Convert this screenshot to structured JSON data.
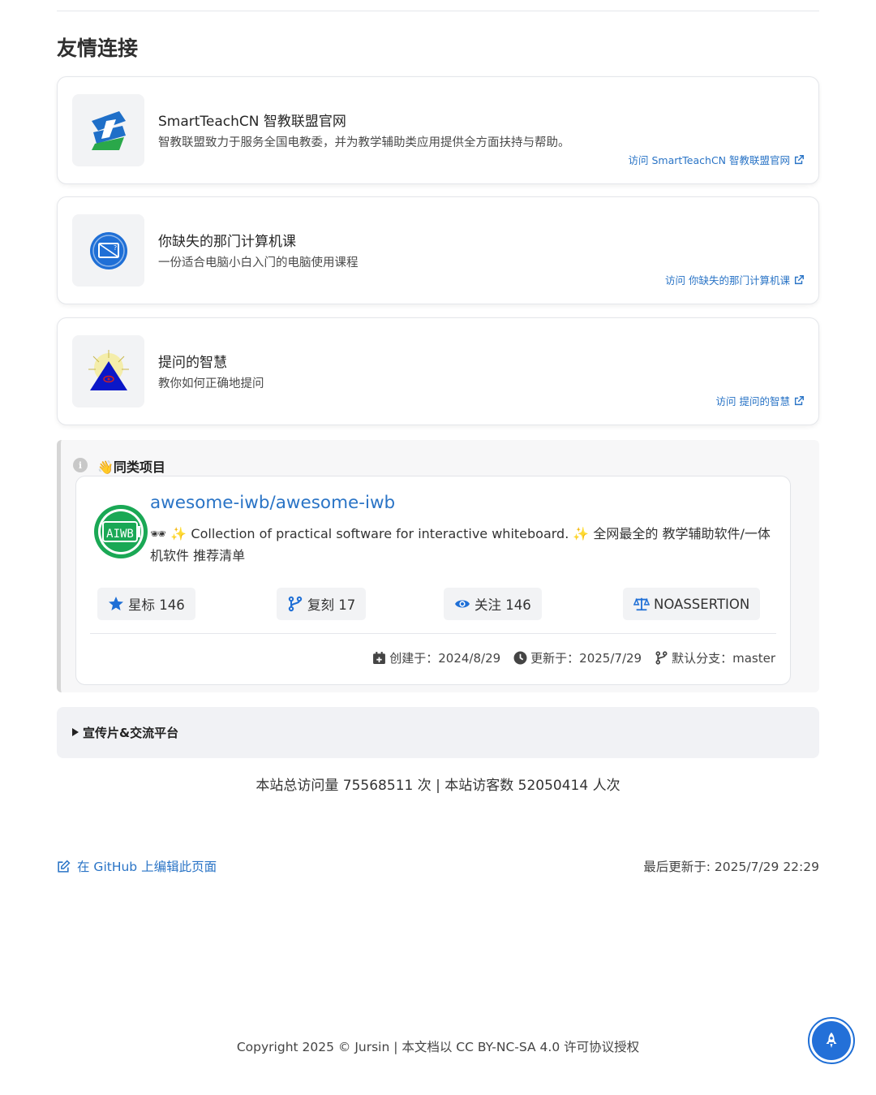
{
  "section": {
    "title": "友情连接"
  },
  "links": [
    {
      "name": "SmartTeachCN 智教联盟官网",
      "desc": "智教联盟致力于服务全国电教委，并为教学辅助类应用提供全方面扶持与帮助。",
      "visit": "访问 SmartTeachCN 智教联盟官网",
      "icon": "smartteach-logo-icon"
    },
    {
      "name": "你缺失的那门计算机课",
      "desc": "一份适合电脑小白入门的电脑使用课程",
      "visit": "访问 你缺失的那门计算机课",
      "icon": "computer-course-logo-icon"
    },
    {
      "name": "提问的智慧",
      "desc": "教你如何正确地提问",
      "visit": "访问 提问的智慧",
      "icon": "smart-questions-logo-icon"
    }
  ],
  "similar": {
    "title": "👋同类项目",
    "repo": {
      "name": "awesome-iwb/awesome-iwb",
      "avatar_text": "AIWB",
      "desc": "🕶 ✨ Collection of practical software for interactive whiteboard. ✨ 全网最全的 教学辅助软件/一体机软件 推荐清单",
      "stars": "星标 146",
      "forks": "复刻 17",
      "watchers": "关注 146",
      "license": "NOASSERTION",
      "created": "创建于：2024/8/29",
      "updated": "更新于：2025/7/29",
      "branch": "默认分支：master"
    }
  },
  "promo": {
    "label": "宣传片&交流平台"
  },
  "footer": {
    "visits": "本站总访问量 75568511 次 | 本站访客数 52050414 人次",
    "edit": "在 GitHub 上编辑此页面",
    "last_updated": "最后更新于: 2025/7/29 22:29",
    "copyright": "Copyright 2025 © Jursin | 本文档以 CC BY-NC-SA 4.0 许可协议授权"
  },
  "colors": {
    "accent": "#2a74c6",
    "rocket": "#2370d8",
    "aiwb_green": "#1aa855"
  }
}
